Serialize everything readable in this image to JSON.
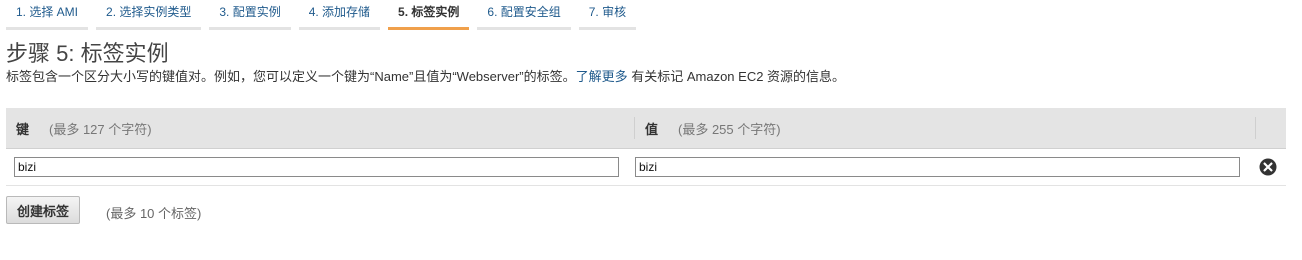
{
  "wizard": {
    "steps": [
      {
        "label": "1. 选择 AMI"
      },
      {
        "label": "2. 选择实例类型"
      },
      {
        "label": "3. 配置实例"
      },
      {
        "label": "4. 添加存储"
      },
      {
        "label": "5. 标签实例"
      },
      {
        "label": "6. 配置安全组"
      },
      {
        "label": "7. 审核"
      }
    ],
    "active_step": 5
  },
  "page": {
    "title": "步骤 5: 标签实例",
    "description_before": "标签包含一个区分大小写的键值对。例如，您可以定义一个键为“Name”且值为“Webserver”的标签。",
    "learn_more": "了解更多",
    "description_after": " 有关标记 Amazon EC2 资源的信息。"
  },
  "table": {
    "key_header": "键",
    "key_hint": "(最多 127 个字符)",
    "value_header": "值",
    "value_hint": "(最多 255 个字符)",
    "rows": [
      {
        "key": "bizi",
        "value": "bizi"
      }
    ]
  },
  "actions": {
    "create_tag": "创建标签",
    "limit_hint": "(最多 10 个标签)"
  },
  "icons": {
    "remove": "remove-circle-icon"
  }
}
